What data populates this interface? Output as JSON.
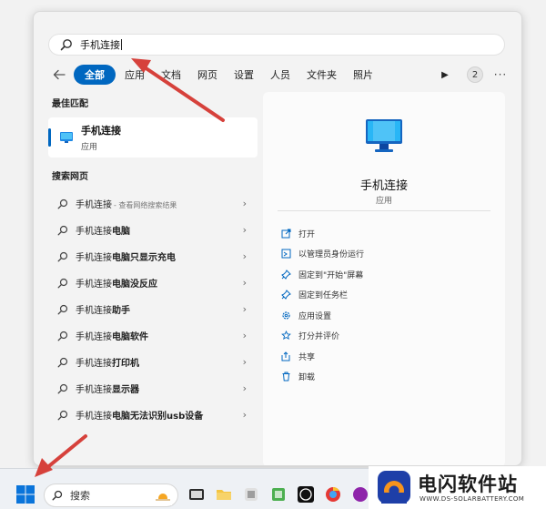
{
  "search": {
    "query": "手机连接"
  },
  "filters": {
    "items": [
      {
        "label": "全部",
        "active": true
      },
      {
        "label": "应用"
      },
      {
        "label": "文档"
      },
      {
        "label": "网页"
      },
      {
        "label": "设置"
      },
      {
        "label": "人员"
      },
      {
        "label": "文件夹"
      },
      {
        "label": "照片"
      }
    ],
    "count_badge": "2"
  },
  "best_match": {
    "section_title": "最佳匹配",
    "name": "手机连接",
    "type": "应用"
  },
  "web": {
    "section_title": "搜索网页",
    "items": [
      {
        "prefix": "手机连接",
        "bold": "",
        "hint": "- 查看网络搜索结果"
      },
      {
        "prefix": "手机连接",
        "bold": "电脑",
        "hint": ""
      },
      {
        "prefix": "手机连接",
        "bold": "电脑只显示充电",
        "hint": ""
      },
      {
        "prefix": "手机连接",
        "bold": "电脑没反应",
        "hint": ""
      },
      {
        "prefix": "手机连接",
        "bold": "助手",
        "hint": ""
      },
      {
        "prefix": "手机连接",
        "bold": "电脑软件",
        "hint": ""
      },
      {
        "prefix": "手机连接",
        "bold": "打印机",
        "hint": ""
      },
      {
        "prefix": "手机连接",
        "bold": "显示器",
        "hint": ""
      },
      {
        "prefix": "手机连接",
        "bold": "电脑无法识别usb设备",
        "hint": ""
      }
    ]
  },
  "detail": {
    "name": "手机连接",
    "type": "应用",
    "actions": [
      {
        "label": "打开",
        "icon": "open-icon"
      },
      {
        "label": "以管理员身份运行",
        "icon": "admin-shield-icon"
      },
      {
        "label": "固定到\"开始\"屏幕",
        "icon": "pin-icon"
      },
      {
        "label": "固定到任务栏",
        "icon": "pin-icon"
      },
      {
        "label": "应用设置",
        "icon": "gear-icon"
      },
      {
        "label": "打分并评价",
        "icon": "star-icon"
      },
      {
        "label": "共享",
        "icon": "share-icon"
      },
      {
        "label": "卸载",
        "icon": "trash-icon"
      }
    ]
  },
  "taskbar": {
    "search_placeholder": "搜索"
  },
  "watermark": {
    "title": "电闪软件站",
    "subtitle": "WWW.DS-SOLARBATTERY.COM"
  },
  "colors": {
    "accent": "#0067c0",
    "arrow": "#d6413b"
  }
}
